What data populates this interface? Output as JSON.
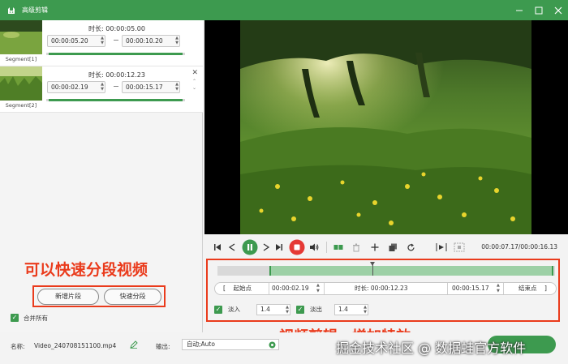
{
  "titlebar": {
    "title": "高级剪辑"
  },
  "segments": [
    {
      "label": "Segment[1]",
      "duration": "时长:  00:00:05.00",
      "start": "00:00:05.20",
      "end": "00:00:10.20",
      "progress": [
        0.02,
        0.98
      ]
    },
    {
      "label": "Segment[2]",
      "duration": "时长:  00:00:12.23",
      "start": "00:00:02.19",
      "end": "00:00:15.17",
      "progress": [
        0.02,
        0.98
      ]
    }
  ],
  "annotations": {
    "left": "可以快速分段视频",
    "right": "视频剪辑、增加特效"
  },
  "buttons": {
    "new_segment": "新增片段",
    "quick_split": "快速分段"
  },
  "merge_all": {
    "label": "合并所有",
    "checked": true
  },
  "player": {
    "time": "00:00:07.17/00:00:16.13",
    "timeline_selection": [
      0.155,
      0.995
    ],
    "playhead": 0.46
  },
  "edit": {
    "start_btn": "起始点",
    "start_value": "00:00:02.19",
    "duration": "时长:  00:00:12.23",
    "end_value": "00:00:15.17",
    "end_btn": "结束点",
    "fade_in_label": "淡入",
    "fade_in_value": "1.4",
    "fade_out_label": "淡出",
    "fade_out_value": "1.4"
  },
  "bottom": {
    "name_label": "名称:",
    "file_name": "Video_240708151100.mp4",
    "output_label": "输出:",
    "output_value": "自动;Auto",
    "watermark": "掘金技术社区 @ 数据蛙官方软件"
  },
  "colors": {
    "accent": "#3d9a4f",
    "annotation": "#ea3b1c",
    "record": "#e53935"
  }
}
